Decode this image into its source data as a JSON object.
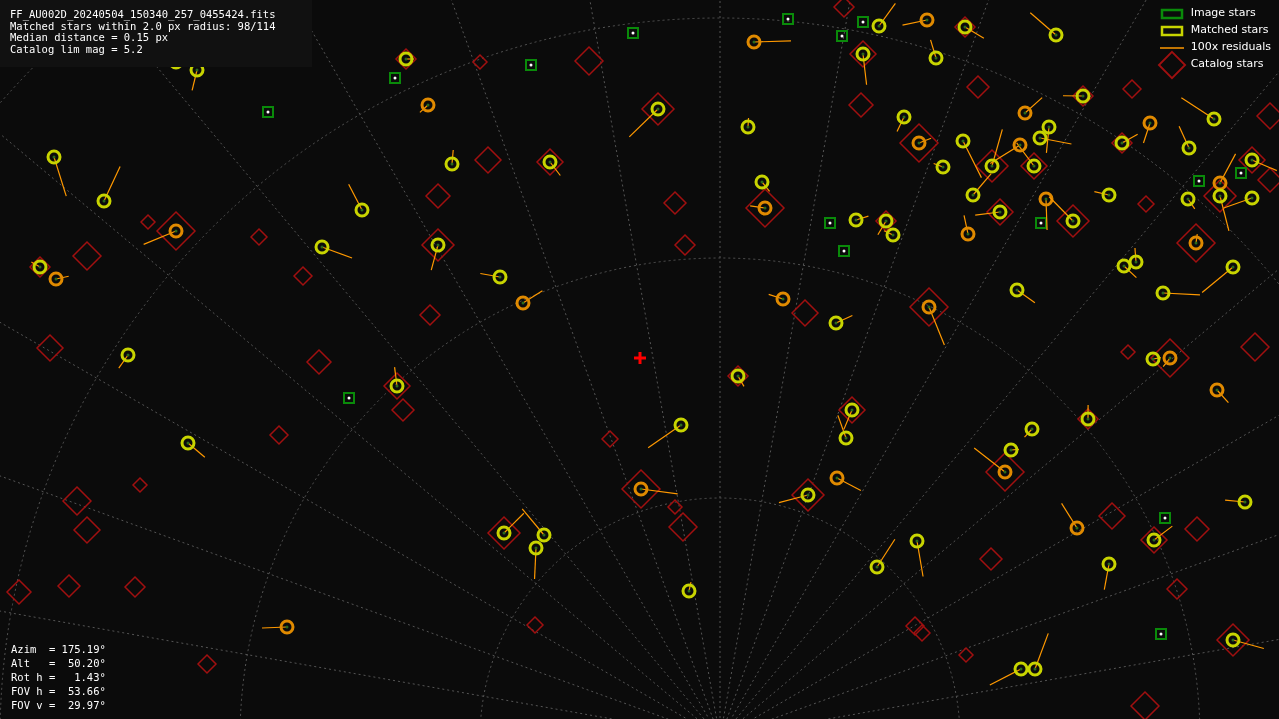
{
  "file_info": {
    "lines": [
      "FF_AU002D_20240504_150340_257_0455424.fits",
      "Matched stars within 2.0 px radius: 98/114",
      "Median distance = 0.15 px",
      "Catalog lim mag = 5.2"
    ]
  },
  "legend": [
    {
      "label": "Image stars",
      "kind": "image"
    },
    {
      "label": "Matched stars",
      "kind": "matched"
    },
    {
      "label": "100x residuals",
      "kind": "residual"
    },
    {
      "label": "Catalog stars",
      "kind": "catalog"
    }
  ],
  "pointing_info": {
    "lines": [
      "Azim  = 175.19°",
      "Alt   =  50.20°",
      "Rot h =   1.43°",
      "FOV h =  53.66°",
      "FOV v =  29.97°"
    ]
  }
}
